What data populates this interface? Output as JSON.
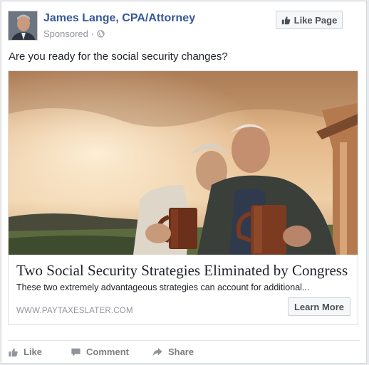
{
  "post": {
    "page_name": "James Lange, CPA/Attorney",
    "sponsored_label": "Sponsored",
    "sponsored_separator": "·",
    "like_page_label": "Like Page",
    "text": "Are you ready for the social security changes?"
  },
  "link_preview": {
    "headline": "Two Social Security Strategies Eliminated by Congress",
    "description": "These two extremely advantageous strategies can account for additional...",
    "domain": "WWW.PAYTAXESLATER.COM",
    "cta_label": "Learn More"
  },
  "actions": {
    "like_label": "Like",
    "comment_label": "Comment",
    "share_label": "Share"
  },
  "colors": {
    "link_blue": "#365899",
    "muted_gray": "#90949c",
    "photo_sky": "#d9a36e"
  },
  "icons": {
    "like_page": "thumbs-up-icon",
    "audience": "globe-icon",
    "like": "thumbs-up-icon",
    "comment": "speech-bubble-icon",
    "share": "share-arrow-icon"
  }
}
